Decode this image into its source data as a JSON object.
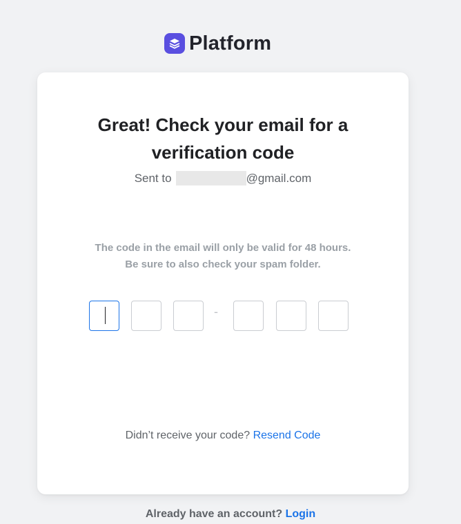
{
  "brand": {
    "name": "Platform",
    "color": "#5a4fe0",
    "icon": "stacked-layers-icon"
  },
  "card": {
    "title": "Great! Check your email for a verification code",
    "sent_prefix": "Sent to",
    "sent_email_domain": "@gmail.com",
    "hint_line1": "The code in the email will only be valid for 48 hours.",
    "hint_line2": "Be sure to also check your spam folder.",
    "code_separator": "-",
    "code_digits": [
      "",
      "",
      "",
      "",
      "",
      ""
    ],
    "resend_prompt": "Didn’t receive your code?",
    "resend_link": "Resend Code"
  },
  "footer": {
    "prompt": "Already have an account?",
    "login_link": "Login"
  },
  "colors": {
    "accent": "#1a73e8",
    "background": "#f1f2f4"
  }
}
